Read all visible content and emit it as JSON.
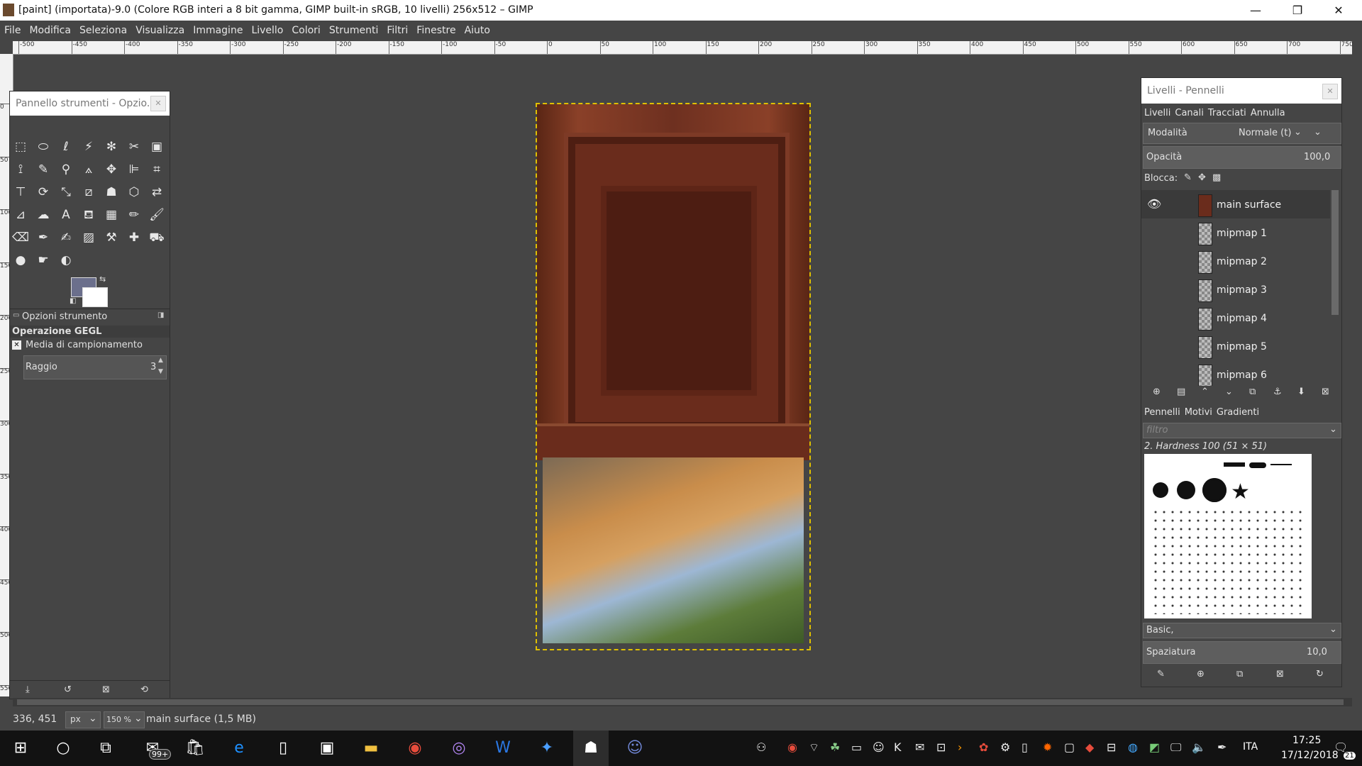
{
  "window": {
    "title": "[paint] (importata)-9.0 (Colore RGB interi a 8 bit gamma, GIMP built-in sRGB, 10 livelli) 256x512 – GIMP",
    "minimize": "—",
    "maximize": "❐",
    "close": "✕"
  },
  "menu": [
    "File",
    "Modifica",
    "Seleziona",
    "Visualizza",
    "Immagine",
    "Livello",
    "Colori",
    "Strumenti",
    "Filtri",
    "Finestre",
    "Aiuto"
  ],
  "ruler": {
    "h_labels": [
      "-500",
      "-450",
      "-400",
      "-350",
      "-300",
      "-250",
      "-200",
      "-150",
      "-100",
      "-50",
      "0",
      "50",
      "100",
      "150",
      "200",
      "250",
      "300",
      "350",
      "400",
      "450",
      "500",
      "550",
      "600",
      "650",
      "700",
      "750"
    ],
    "v_labels": [
      "0",
      "50",
      "100",
      "150",
      "200",
      "250",
      "300",
      "350",
      "400",
      "450",
      "500",
      "550"
    ]
  },
  "toolbox": {
    "title": "Pannello strumenti - Opzio...",
    "options_title": "Opzioni strumento",
    "operation": "Operazione GEGL",
    "checkbox_label": "Media di campionamento",
    "radius_label": "Raggio",
    "radius_value": "3",
    "fg_color": "#6b6f8c",
    "bg_color": "#ffffff"
  },
  "dock": {
    "title": "Livelli - Pennelli",
    "tabs": [
      "Livelli",
      "Canali",
      "Tracciati",
      "Annulla"
    ],
    "mode_label": "Modalità",
    "mode_value": "Normale (t)",
    "opacity_label": "Opacità",
    "opacity_value": "100,0",
    "lock_label": "Blocca:",
    "layers": [
      "main surface",
      "mipmap 1",
      "mipmap 2",
      "mipmap 3",
      "mipmap 4",
      "mipmap 5",
      "mipmap 6"
    ],
    "brush_tabs": [
      "Pennelli",
      "Motivi",
      "Gradienti"
    ],
    "filter_placeholder": "filtro",
    "brush_name": "2. Hardness 100 (51 × 51)",
    "brush_set": "Basic,",
    "spacing_label": "Spaziatura",
    "spacing_value": "10,0"
  },
  "status": {
    "coords": "336, 451",
    "unit": "px",
    "zoom": "150 %",
    "info": "main surface (1,5 MB)"
  },
  "taskbar": {
    "badge": "99+",
    "lang": "ITA",
    "time": "17:25",
    "date": "17/12/2018",
    "notif": "21"
  }
}
